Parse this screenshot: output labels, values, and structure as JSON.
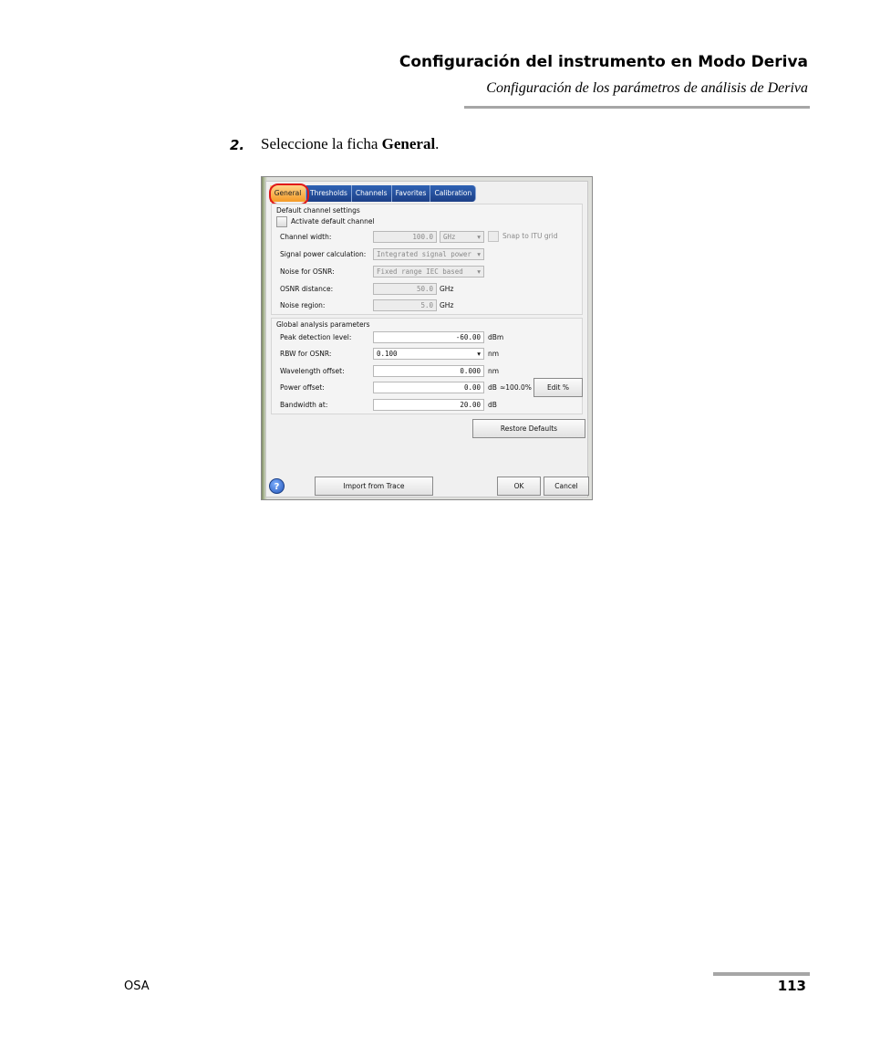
{
  "header": {
    "title": "Configuración del instrumento en Modo Deriva",
    "subtitle": "Configuración de los parámetros de análisis de Deriva"
  },
  "step": {
    "number": "2.",
    "text_before": "Seleccione la ficha ",
    "text_bold": "General",
    "text_after": "."
  },
  "dialog": {
    "tabs": [
      "General",
      "Thresholds",
      "Channels",
      "Favorites",
      "Calibration"
    ],
    "default_channel": {
      "group_label": "Default channel settings",
      "activate_label": "Activate default channel",
      "channel_width_label": "Channel width:",
      "channel_width_value": "100.0",
      "channel_width_unit": "GHz",
      "snap_label": "Snap to ITU grid",
      "signal_power_label": "Signal power calculation:",
      "signal_power_value": "Integrated signal power",
      "noise_osnr_label": "Noise for OSNR:",
      "noise_osnr_value": "Fixed range IEC based",
      "osnr_distance_label": "OSNR distance:",
      "osnr_distance_value": "50.0",
      "osnr_distance_unit": "GHz",
      "noise_region_label": "Noise region:",
      "noise_region_value": "5.0",
      "noise_region_unit": "GHz"
    },
    "global": {
      "group_label": "Global analysis parameters",
      "peak_label": "Peak detection level:",
      "peak_value": "-60.00",
      "peak_unit": "dBm",
      "rbw_label": "RBW for OSNR:",
      "rbw_value": "0.100",
      "rbw_unit": "nm",
      "wl_offset_label": "Wavelength offset:",
      "wl_offset_value": "0.000",
      "wl_offset_unit": "nm",
      "power_offset_label": "Power offset:",
      "power_offset_value": "0.00",
      "power_offset_unit": "dB",
      "power_offset_pct": "≈100.0%",
      "edit_pct_label": "Edit %",
      "bandwidth_label": "Bandwidth at:",
      "bandwidth_value": "20.00",
      "bandwidth_unit": "dB"
    },
    "restore_label": "Restore Defaults",
    "help_label": "?",
    "import_label": "Import from Trace",
    "ok_label": "OK",
    "cancel_label": "Cancel"
  },
  "footer": {
    "left": "OSA",
    "page_number": "113"
  }
}
